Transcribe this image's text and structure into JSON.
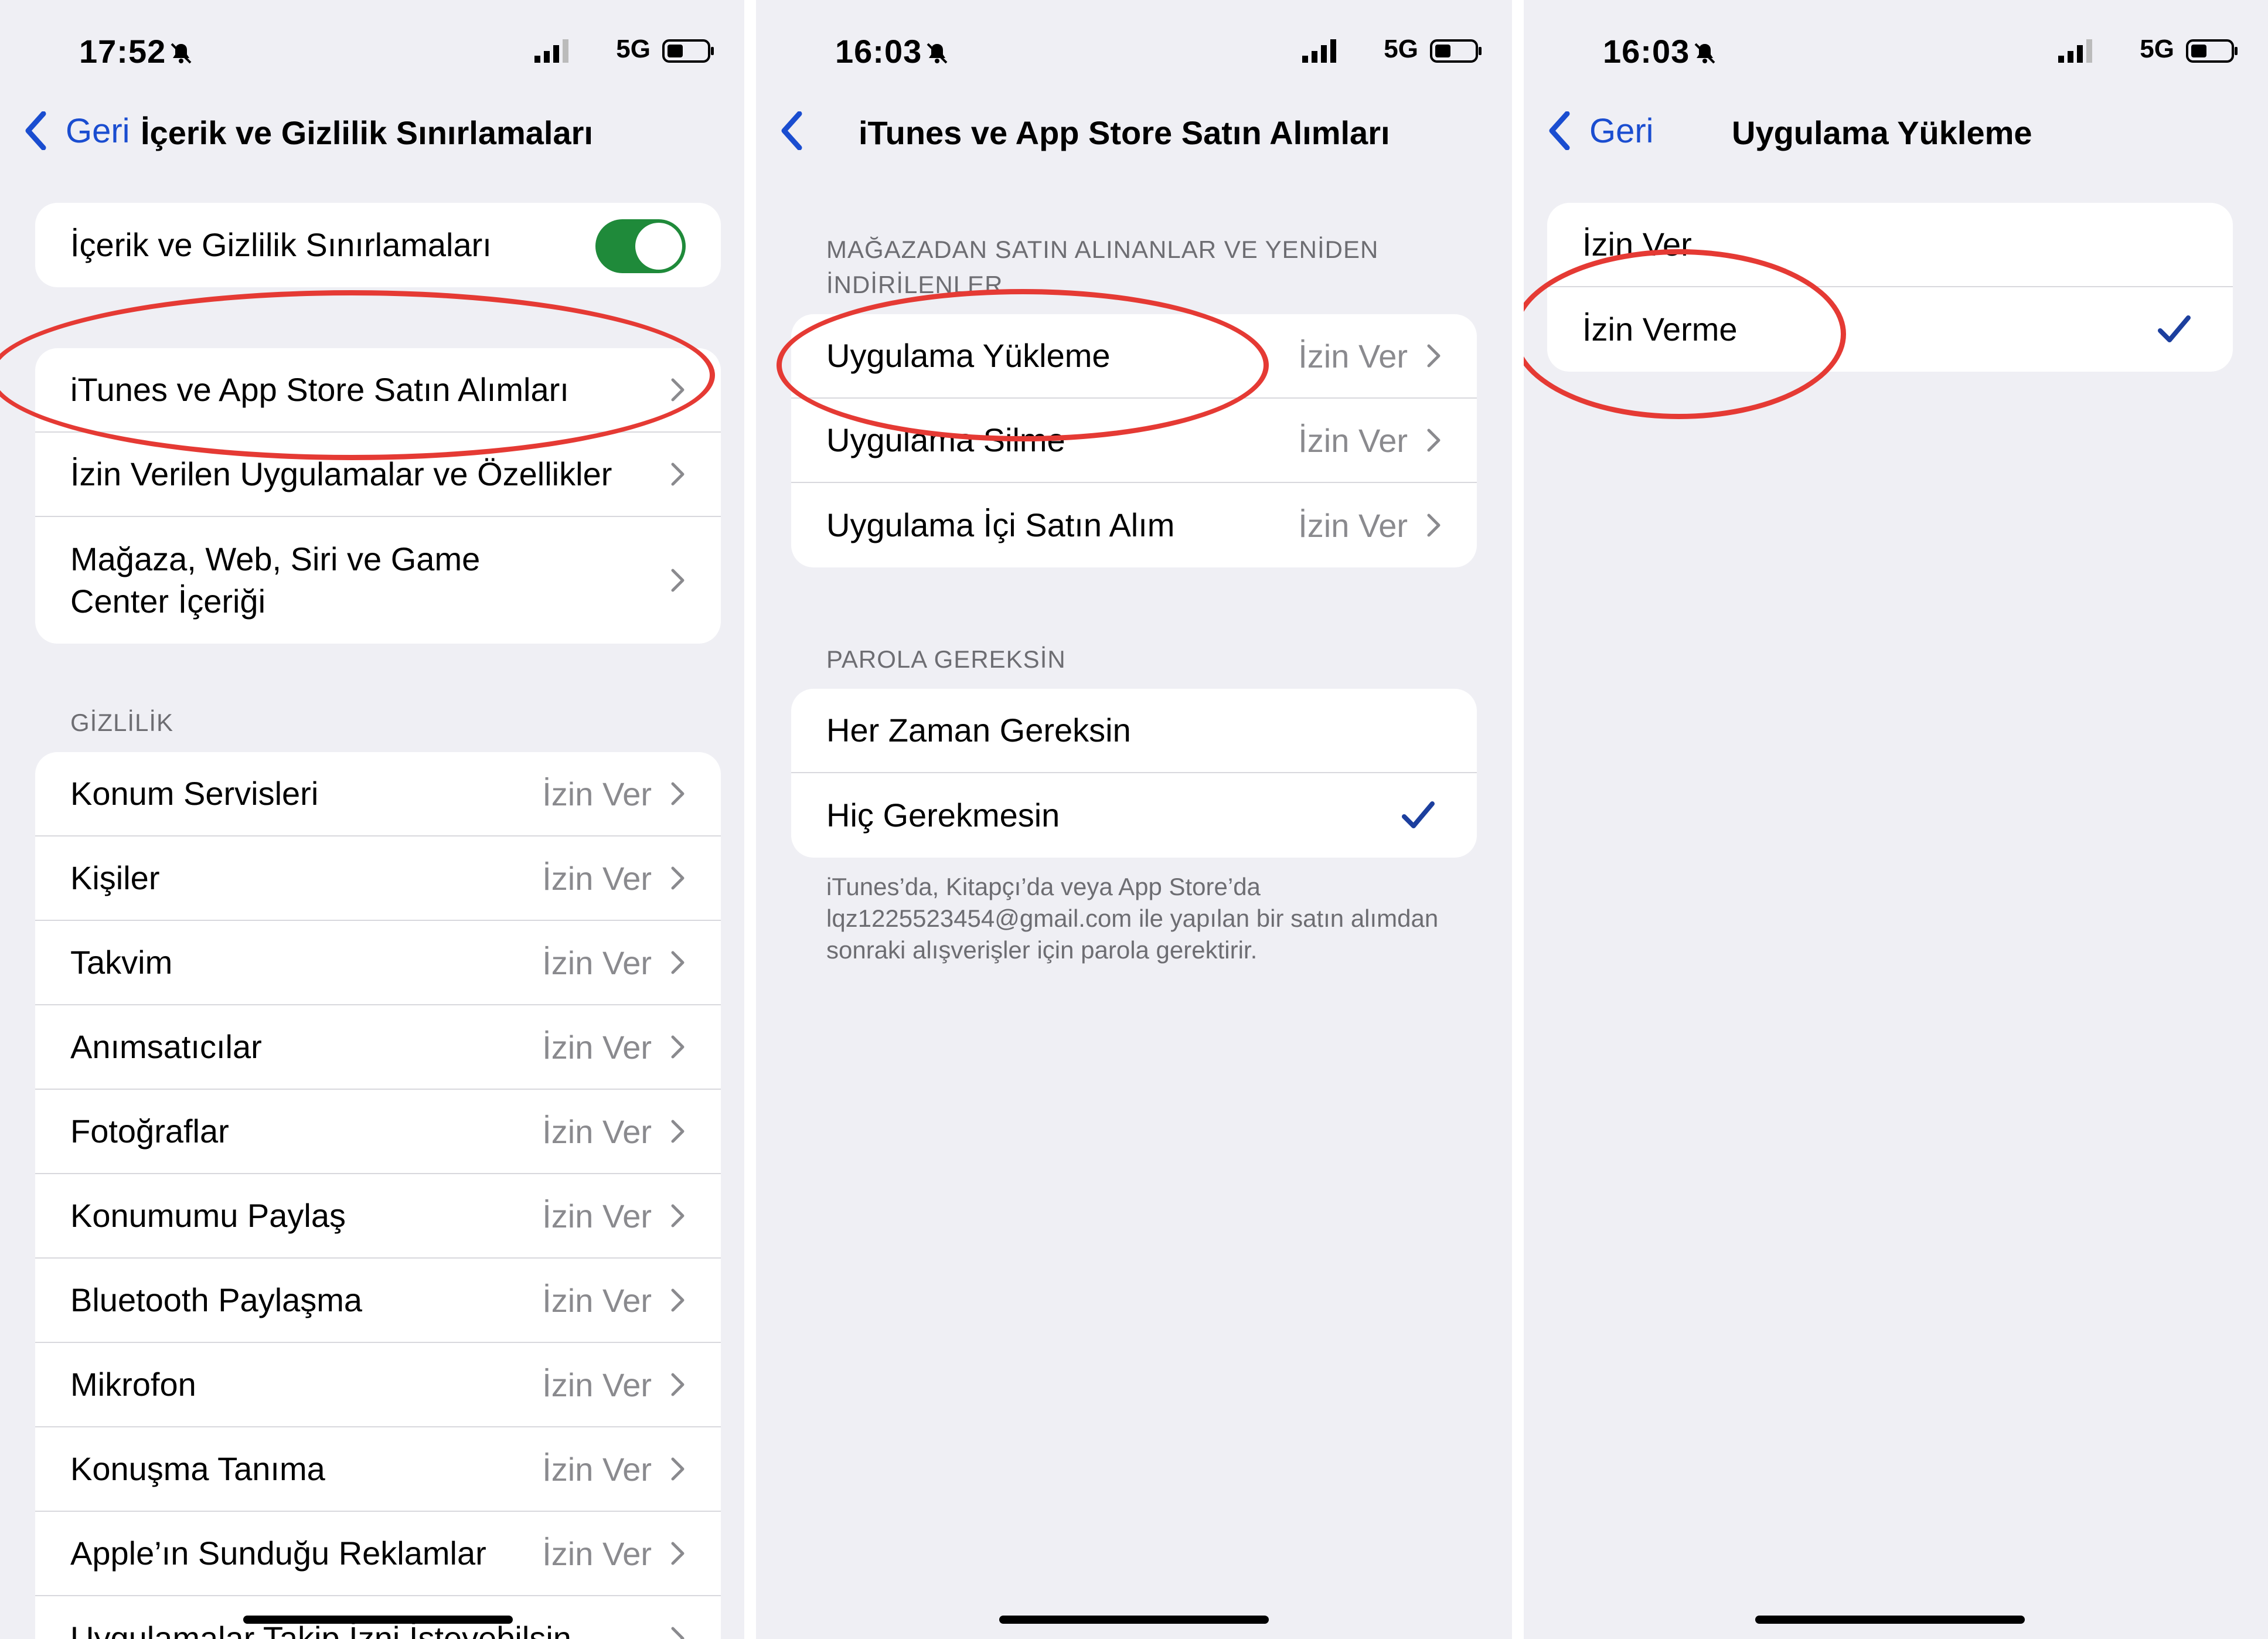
{
  "screen1": {
    "status": {
      "time": "17:52",
      "network": "5G"
    },
    "nav": {
      "back_label": "Geri",
      "title": "İçerik ve Gizlilik Sınırlamaları"
    },
    "toggle_row": {
      "label": "İçerik ve Gizlilik Sınırlamaları",
      "toggle_on": true
    },
    "menu": [
      {
        "label": "iTunes ve App Store Satın Alımları"
      },
      {
        "label": "İzin Verilen Uygulamalar ve Özellikler"
      },
      {
        "label": "Mağaza, Web, Siri ve Game Center İçeriği"
      }
    ],
    "privacy_header": "GİZLİLİK",
    "privacy_items": [
      {
        "label": "Konum Servisleri",
        "value": "İzin Ver"
      },
      {
        "label": "Kişiler",
        "value": "İzin Ver"
      },
      {
        "label": "Takvim",
        "value": "İzin Ver"
      },
      {
        "label": "Anımsatıcılar",
        "value": "İzin Ver"
      },
      {
        "label": "Fotoğraflar",
        "value": "İzin Ver"
      },
      {
        "label": "Konumumu Paylaş",
        "value": "İzin Ver"
      },
      {
        "label": "Bluetooth Paylaşma",
        "value": "İzin Ver"
      },
      {
        "label": "Mikrofon",
        "value": "İzin Ver"
      },
      {
        "label": "Konuşma Tanıma",
        "value": "İzin Ver"
      },
      {
        "label": "Apple’ın Sunduğu Reklamlar",
        "value": "İzin Ver"
      },
      {
        "label": "Uygulamalar Takip İzni İsteyebilsin",
        "value": ""
      }
    ]
  },
  "screen2": {
    "status": {
      "time": "16:03",
      "network": "5G"
    },
    "nav": {
      "title": "iTunes ve App Store Satın Alımları"
    },
    "store_header": "MAĞAZADAN SATIN ALINANLAR VE YENİDEN İNDİRİLENLER",
    "store_items": [
      {
        "label": "Uygulama Yükleme",
        "value": "İzin Ver"
      },
      {
        "label": "Uygulama Silme",
        "value": "İzin Ver"
      },
      {
        "label": "Uygulama İçi Satın Alım",
        "value": "İzin Ver"
      }
    ],
    "password_header": "PAROLA GEREKSİN",
    "password_options": [
      {
        "label": "Her Zaman Gereksin",
        "checked": false
      },
      {
        "label": "Hiç Gerekmesin",
        "checked": true
      }
    ],
    "footer": "iTunes’da, Kitapçı’da veya App Store’da lqz1225523454@gmail.com ile yapılan bir satın alımdan sonraki alışverişler için parola gerektirir."
  },
  "screen3": {
    "status": {
      "time": "16:03",
      "network": "5G"
    },
    "nav": {
      "back_label": "Geri",
      "title": "Uygulama Yükleme"
    },
    "options": [
      {
        "label": "İzin Ver",
        "checked": false
      },
      {
        "label": "İzin Verme",
        "checked": true
      }
    ]
  },
  "colors": {
    "accent": "#1a4dd0",
    "toggle_on": "#1f8a3a",
    "annotation": "#e53a34",
    "checkmark": "#1c3f9e"
  }
}
